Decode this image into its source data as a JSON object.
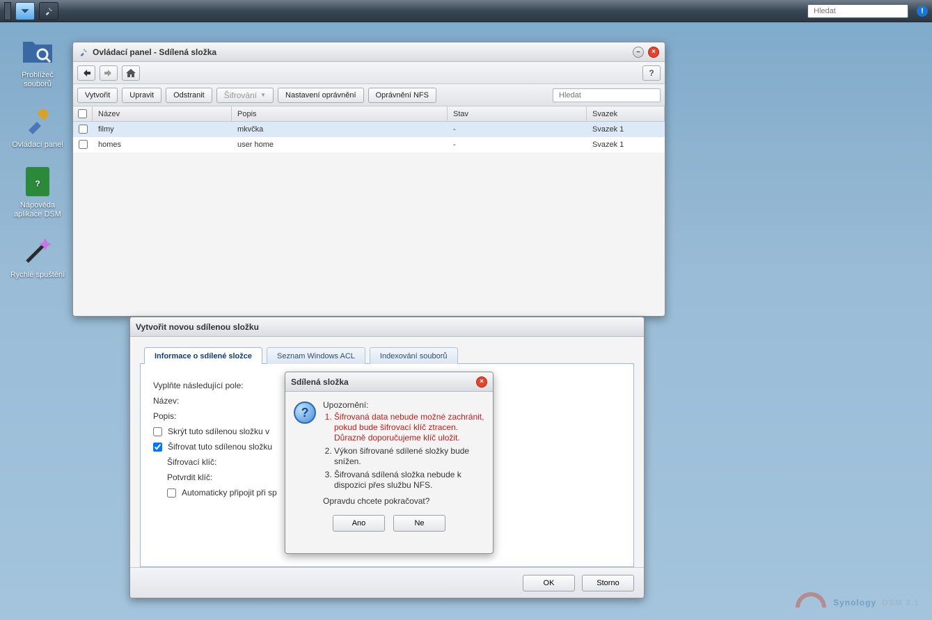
{
  "taskbar": {
    "search_placeholder": "Hledat"
  },
  "desktop": {
    "file_browser": "Prohlížeč souborů",
    "control_panel": "Ovládací panel",
    "help": "Nápověda aplikace DSM",
    "quickstart": "Rychlé spuštění"
  },
  "cp": {
    "title": "Ovládací panel - Sdílená složka",
    "buttons": {
      "create": "Vytvořit",
      "edit": "Upravit",
      "delete": "Odstranit",
      "encrypt": "Šifrování",
      "perm": "Nastavení oprávnění",
      "nfs": "Oprávnění NFS"
    },
    "search_placeholder": "Hledat",
    "cols": {
      "name": "Název",
      "desc": "Popis",
      "state": "Stav",
      "volume": "Svazek"
    },
    "rows": [
      {
        "name": "filmy",
        "desc": "mkvčka",
        "state": "-",
        "volume": "Svazek 1"
      },
      {
        "name": "homes",
        "desc": "user home",
        "state": "-",
        "volume": "Svazek 1"
      }
    ]
  },
  "dlg": {
    "title": "Vytvořit novou sdílenou složku",
    "tabs": {
      "info": "Informace o sdílené složce",
      "acl": "Seznam Windows ACL",
      "index": "Indexování souborů"
    },
    "fill_fields": "Vyplňte následující pole:",
    "name_label": "Název:",
    "desc_label": "Popis:",
    "hide": "Skrýt tuto sdílenou složku v",
    "encrypt": "Šifrovat tuto sdílenou složku",
    "key": "Šifrovací klíč:",
    "confirm_key": "Potvrdit klíč:",
    "automount": "Automaticky připojit při sp",
    "ok": "OK",
    "cancel": "Storno"
  },
  "alert": {
    "title": "Sdílená složka",
    "heading": "Upozornění:",
    "item1": "Šifrovaná data nebude možné zachránit, pokud bude šifrovací klíč ztracen. Důrazně doporučujeme klíč uložit.",
    "item2": "Výkon šifrované sdílené složky bude snížen.",
    "item3": "Šifrovaná sdílená složka nebude k dispozici přes službu NFS.",
    "question": "Opravdu chcete pokračovat?",
    "yes": "Ano",
    "no": "Ne"
  },
  "watermark": {
    "brand": "Synology",
    "model": "DSM 3.1"
  }
}
